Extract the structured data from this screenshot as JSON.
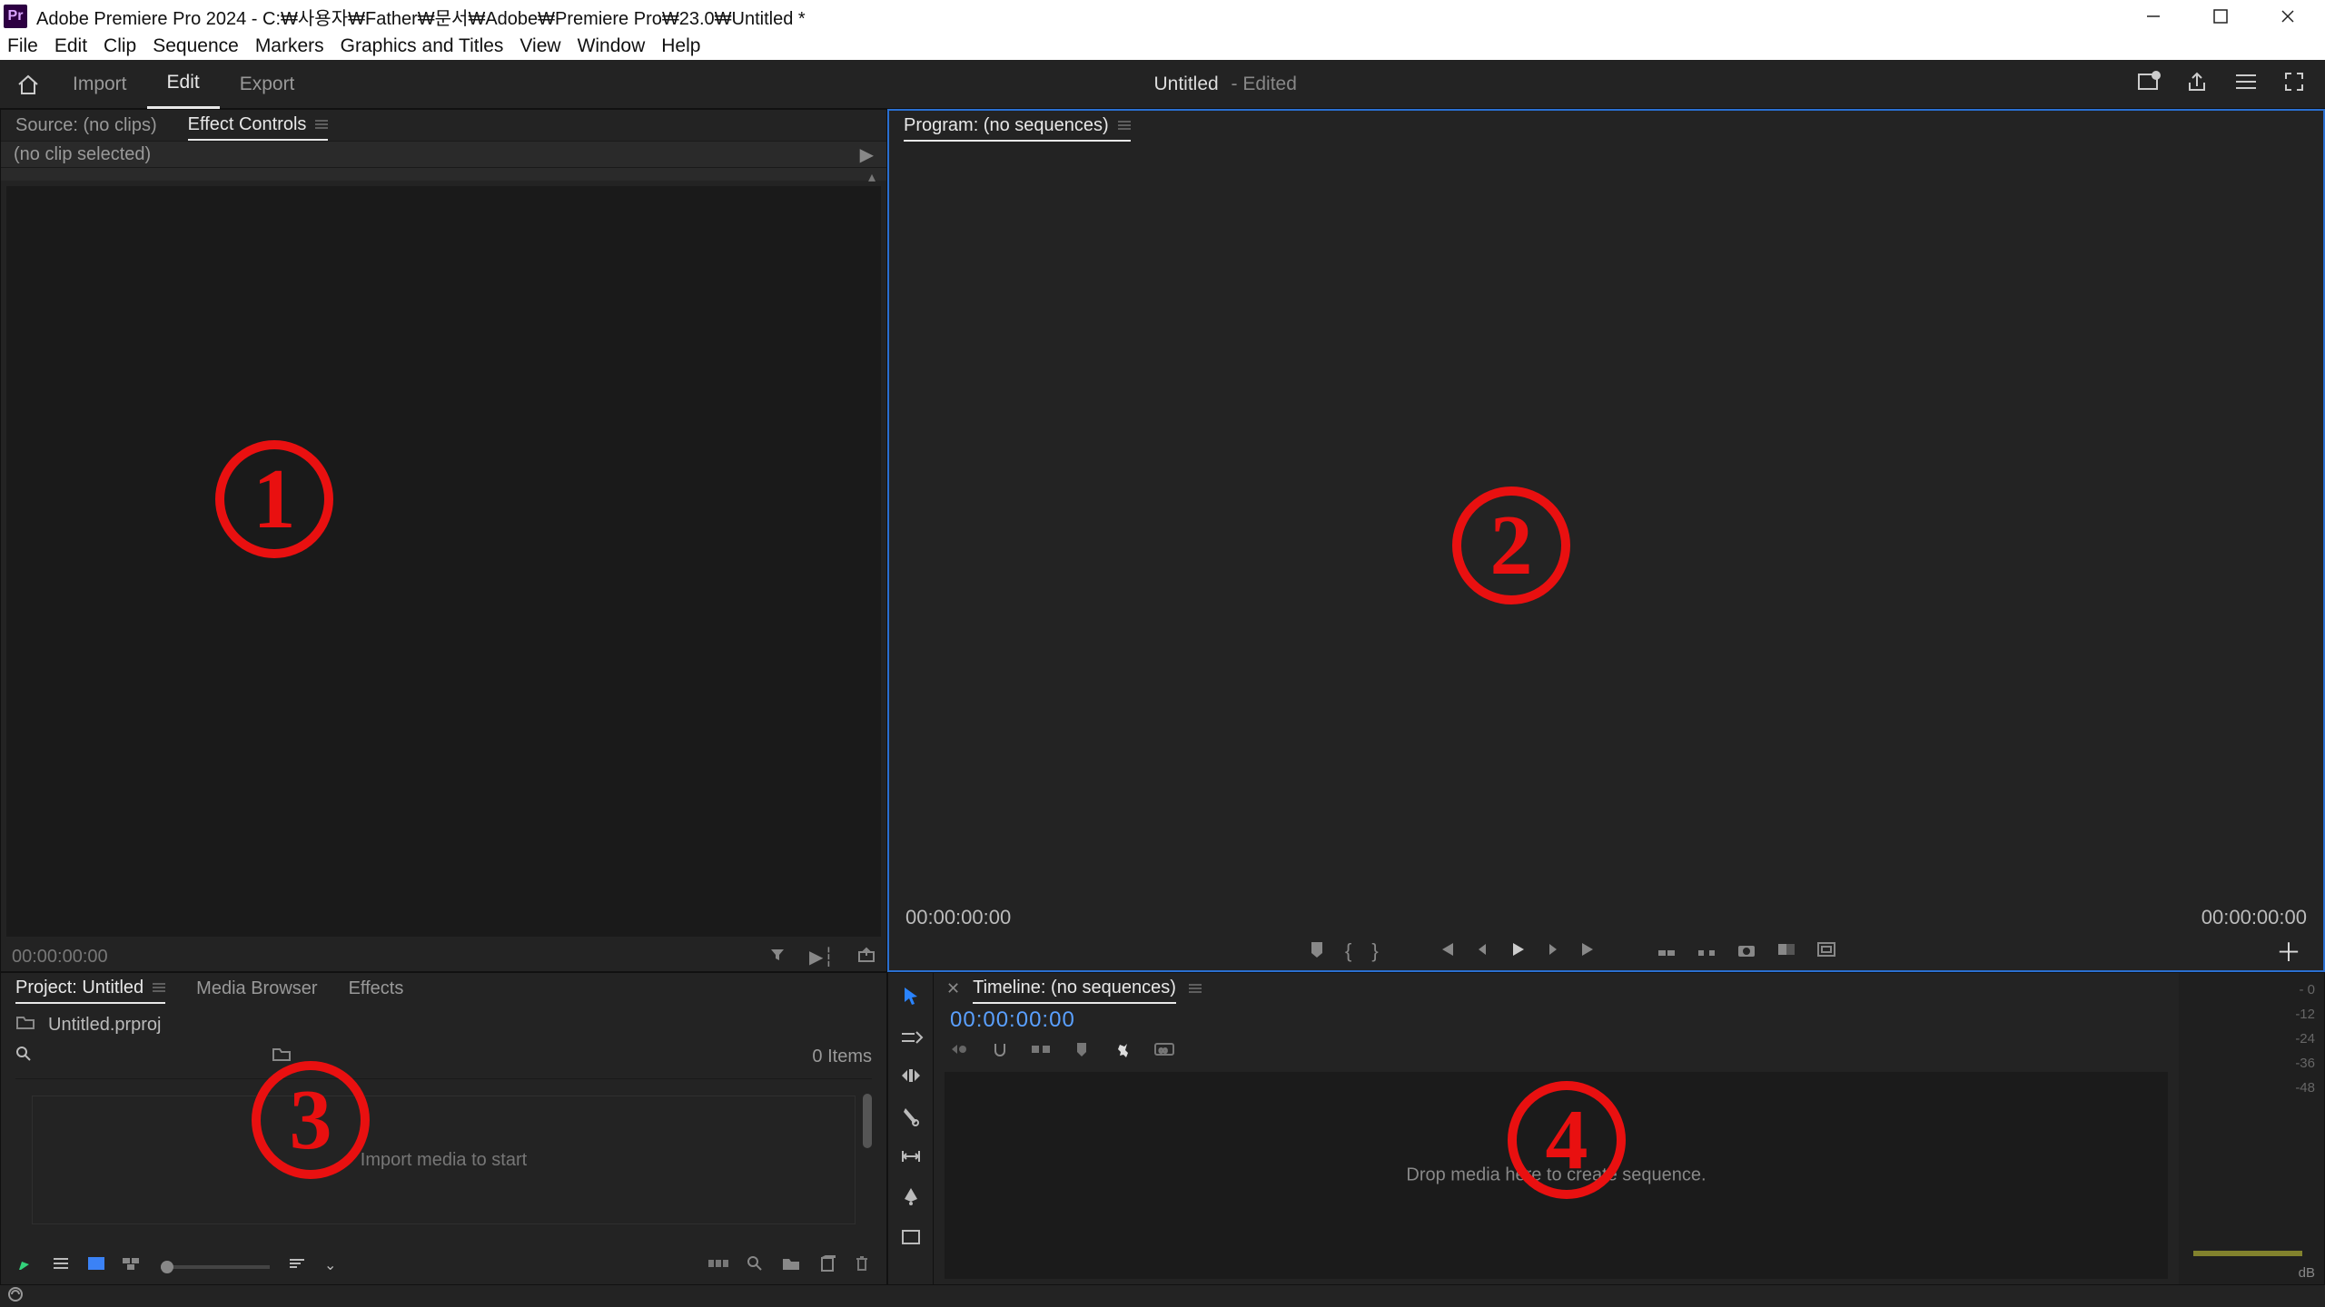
{
  "titlebar": {
    "app_icon_text": "Pr",
    "title": "Adobe Premiere Pro 2024 - C:₩사용자₩Father₩문서₩Adobe₩Premiere Pro₩23.0₩Untitled *"
  },
  "menu": [
    "File",
    "Edit",
    "Clip",
    "Sequence",
    "Markers",
    "Graphics and Titles",
    "View",
    "Window",
    "Help"
  ],
  "topbar": {
    "home_icon": "home",
    "modes": {
      "import": "Import",
      "edit": "Edit",
      "export": "Export"
    },
    "doc_title": "Untitled",
    "doc_status": "- Edited"
  },
  "source_panel": {
    "tabs": {
      "source": "Source: (no clips)",
      "effect_controls": "Effect Controls"
    },
    "subhead": "(no clip selected)",
    "timecode": "00:00:00:00",
    "annotation": "1"
  },
  "program_panel": {
    "tab": "Program: (no sequences)",
    "tc_left": "00:00:00:00",
    "tc_right": "00:00:00:00",
    "annotation": "2"
  },
  "project_panel": {
    "tabs": {
      "project": "Project: Untitled",
      "media_browser": "Media Browser",
      "effects": "Effects"
    },
    "bin_label": "Untitled.prproj",
    "item_count": "0 Items",
    "hint": "Import media to start",
    "annotation": "3"
  },
  "timeline_panel": {
    "tab": "Timeline: (no sequences)",
    "timecode": "00:00:00:00",
    "hint": "Drop media here to create sequence.",
    "annotation": "4"
  },
  "meters": {
    "ticks": [
      "- 0",
      "-12",
      "-24",
      "-36",
      "-48"
    ],
    "unit": "dB"
  },
  "tools": [
    "selection",
    "track-select",
    "ripple",
    "razor",
    "slip",
    "pen",
    "rectangle"
  ]
}
